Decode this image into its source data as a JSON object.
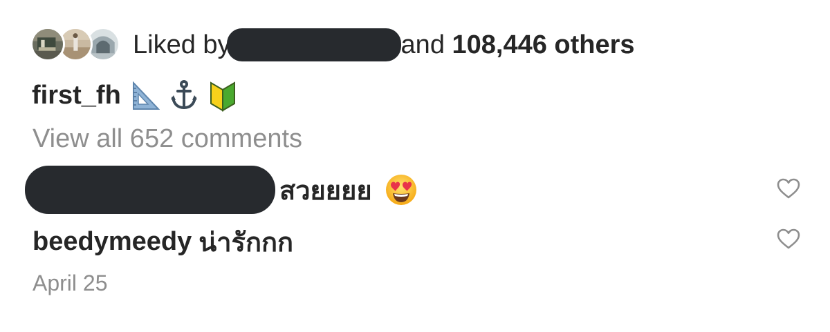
{
  "likes": {
    "prefix": "Liked by",
    "connector": "and",
    "count_text": "108,446 others"
  },
  "caption": {
    "username": "first_fh",
    "emojis": [
      "triangular-ruler",
      "anchor",
      "beginner-symbol"
    ]
  },
  "view_all_comments": "View all 652 comments",
  "comments": [
    {
      "text": "สวยยยย",
      "emoji": "heart-eyes-face",
      "like_icon": "heart-outline-icon"
    },
    {
      "username": "beedymeedy",
      "text": "น่ารักกก",
      "like_icon": "heart-outline-icon"
    }
  ],
  "timestamp": "April 25",
  "colors": {
    "text_primary": "#262626",
    "text_secondary": "#8e8e8e",
    "redaction": "#272a2e",
    "heart_outline": "#8e8e8e"
  }
}
